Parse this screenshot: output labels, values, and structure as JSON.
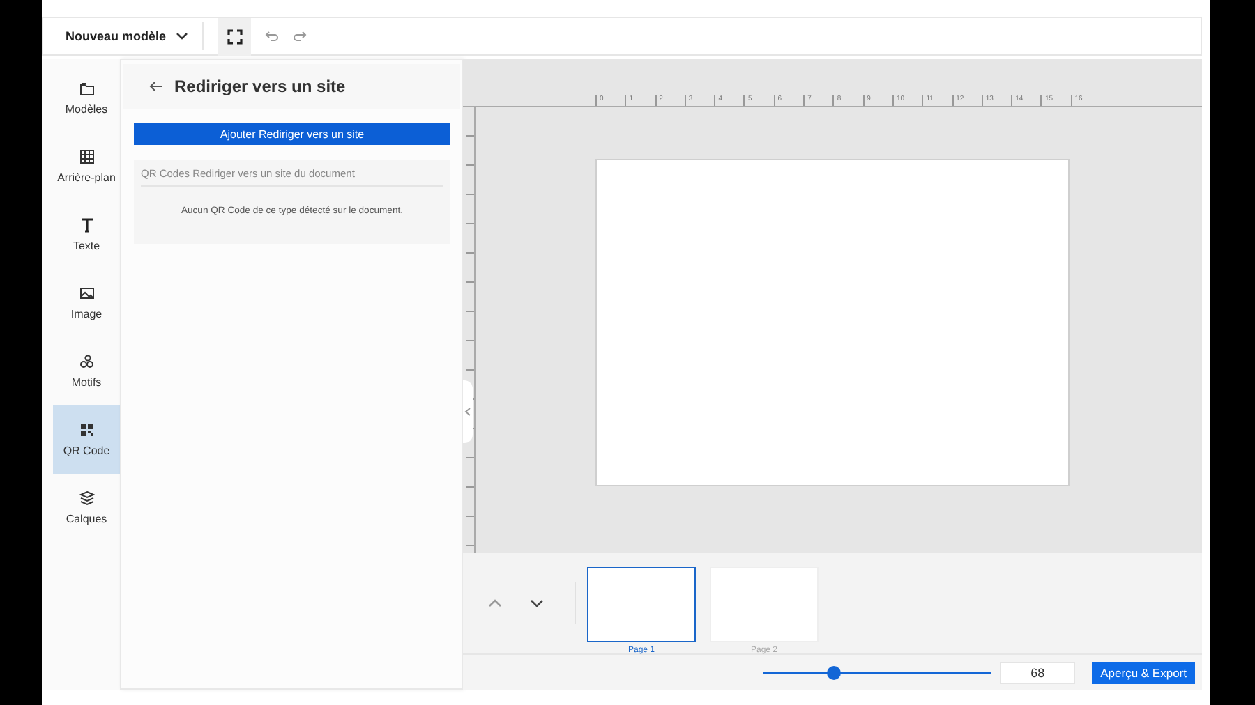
{
  "toolbar": {
    "template_menu": "Nouveau modèle"
  },
  "sidebar": {
    "items": [
      {
        "label": "Modèles",
        "kind": "folders",
        "selected": false
      },
      {
        "label": "Arrière-plan",
        "kind": "grid",
        "selected": false
      },
      {
        "label": "Texte",
        "kind": "text",
        "selected": false
      },
      {
        "label": "Image",
        "kind": "image",
        "selected": false
      },
      {
        "label": "Motifs",
        "kind": "shapes",
        "selected": false
      },
      {
        "label": "QR Code",
        "kind": "qr",
        "selected": true
      },
      {
        "label": "Calques",
        "kind": "layers",
        "selected": false
      }
    ]
  },
  "panel": {
    "title": "Rediriger vers un site",
    "add_button": "Ajouter Rediriger vers un site",
    "section_title": "QR Codes Rediriger vers un site du document",
    "empty_message": "Aucun QR Code de ce type détecté sur le document."
  },
  "ruler": {
    "labels": [
      "0",
      "1",
      "2",
      "3",
      "4",
      "5",
      "6",
      "7",
      "8",
      "9",
      "10",
      "11",
      "12",
      "13",
      "14",
      "15",
      "16"
    ]
  },
  "pages": [
    {
      "label": "Page 1",
      "selected": true
    },
    {
      "label": "Page 2",
      "selected": false
    }
  ],
  "zoom": {
    "level": 0.31,
    "value": "68"
  },
  "export_button": "Aperçu & Export"
}
